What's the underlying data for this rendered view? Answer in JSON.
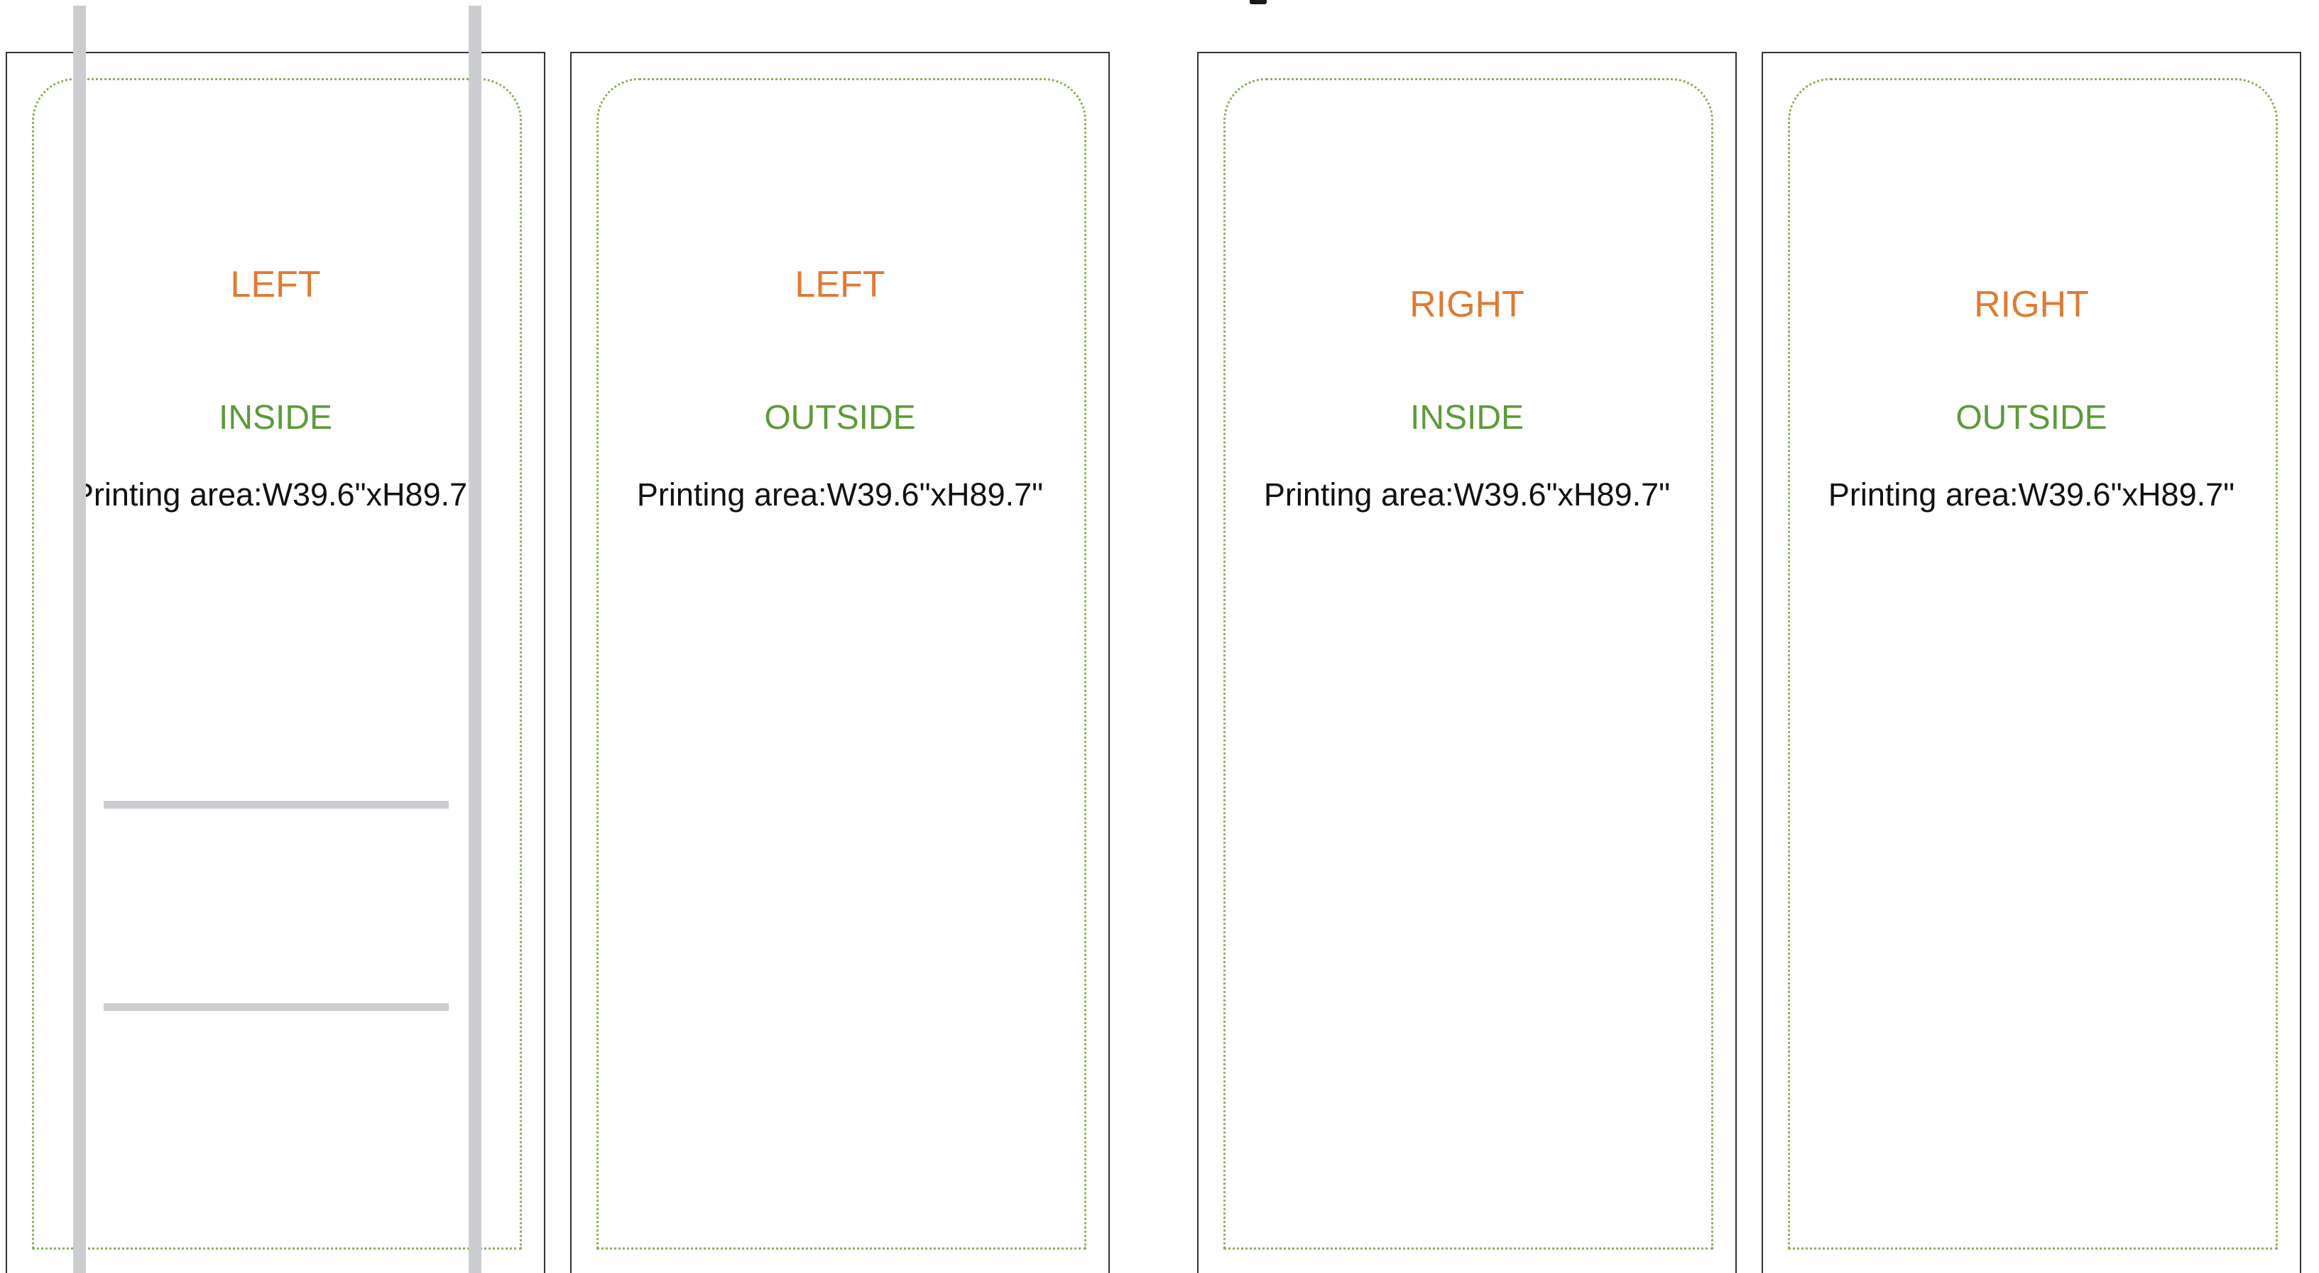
{
  "colors": {
    "side_label": "#e07a34",
    "face_label": "#5c9b3a",
    "area_label": "#111111",
    "printing_area_border": "#8bb05a",
    "panel_border": "#333333",
    "guide_lines": "#cccdd0"
  },
  "panels": [
    {
      "side": "LEFT",
      "face": "INSIDE",
      "printing_area": "Printing area:W39.6\"xH89.7\""
    },
    {
      "side": "LEFT",
      "face": "OUTSIDE",
      "printing_area": "Printing area:W39.6\"xH89.7\""
    },
    {
      "side": "RIGHT",
      "face": "INSIDE",
      "printing_area": "Printing area:W39.6\"xH89.7\""
    },
    {
      "side": "RIGHT",
      "face": "OUTSIDE",
      "printing_area": "Printing area:W39.6\"xH89.7\""
    }
  ]
}
